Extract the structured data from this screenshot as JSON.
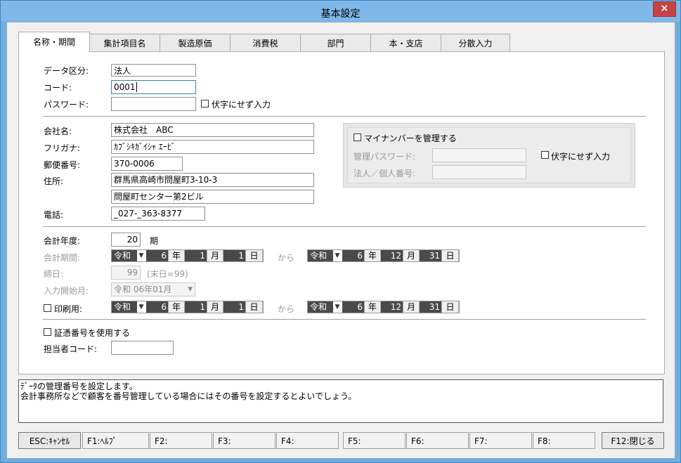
{
  "window": {
    "title": "基本設定",
    "close_glyph": "×"
  },
  "tabs": [
    "名称・期間",
    "集計項目名",
    "製造原価",
    "消費税",
    "部門",
    "本・支店",
    "分散入力"
  ],
  "form": {
    "data_kbn_label": "データ区分:",
    "data_kbn_value": "法人",
    "code_label": "コード:",
    "code_value": "0001",
    "password_label": "パスワード:",
    "password_value": "",
    "mask_label": "伏字にせず入力",
    "company_label": "会社名:",
    "company_value": "株式会社　ABC",
    "furigana_label": "フリガナ:",
    "furigana_value": "ｶﾌﾞｼｷｶﾞｲｼｬ ｴｰﾋﾞ",
    "zip_label": "郵便番号:",
    "zip_value": "370-0006",
    "address_label": "住所:",
    "address1_value": "群馬県高崎市問屋町3-10-3",
    "address2_value": "問屋町センター第2ビル",
    "tel_label": "電話:",
    "tel_value": "_027-_363-8377",
    "fiscal_label": "会計年度:",
    "fiscal_value": "20",
    "fiscal_unit": "期",
    "period_label": "会計期間:",
    "close_label": "締日:",
    "close_value": "99",
    "close_hint": "(末日=99)",
    "input_start_label": "入力開始月:",
    "input_start_value": "令和 06年01月",
    "print_label": "印刷用:",
    "kara": "から",
    "voucher_label": "証憑番号を使用する",
    "staff_label": "担当者コード:",
    "staff_value": ""
  },
  "mynumber": {
    "manage_label": "マイナンバーを管理する",
    "password_label": "管理パスワード:",
    "corp_label": "法人／個人番号:",
    "mask_label": "伏字にせず入力"
  },
  "dates": {
    "era": "令和",
    "nen": "年",
    "tsuki": "月",
    "hi": "日",
    "period_from": {
      "y": "6",
      "m": "1",
      "d": "1"
    },
    "period_to": {
      "y": "6",
      "m": "12",
      "d": "31"
    },
    "print_from": {
      "y": "6",
      "m": "1",
      "d": "1"
    },
    "print_to": {
      "y": "6",
      "m": "12",
      "d": "31"
    }
  },
  "help": {
    "line1": "ﾃﾞｰﾀの管理番号を設定します。",
    "line2": "会計事務所などで顧客を番号管理している場合にはその番号を設定するとよいでしょう。"
  },
  "fkeys": [
    "ESC:ｷｬﾝｾﾙ",
    "F1:ﾍﾙﾌﾟ",
    "F2:",
    "F3:",
    "F4:",
    "F5:",
    "F6:",
    "F7:",
    "F8:",
    "F12:閉じる"
  ]
}
